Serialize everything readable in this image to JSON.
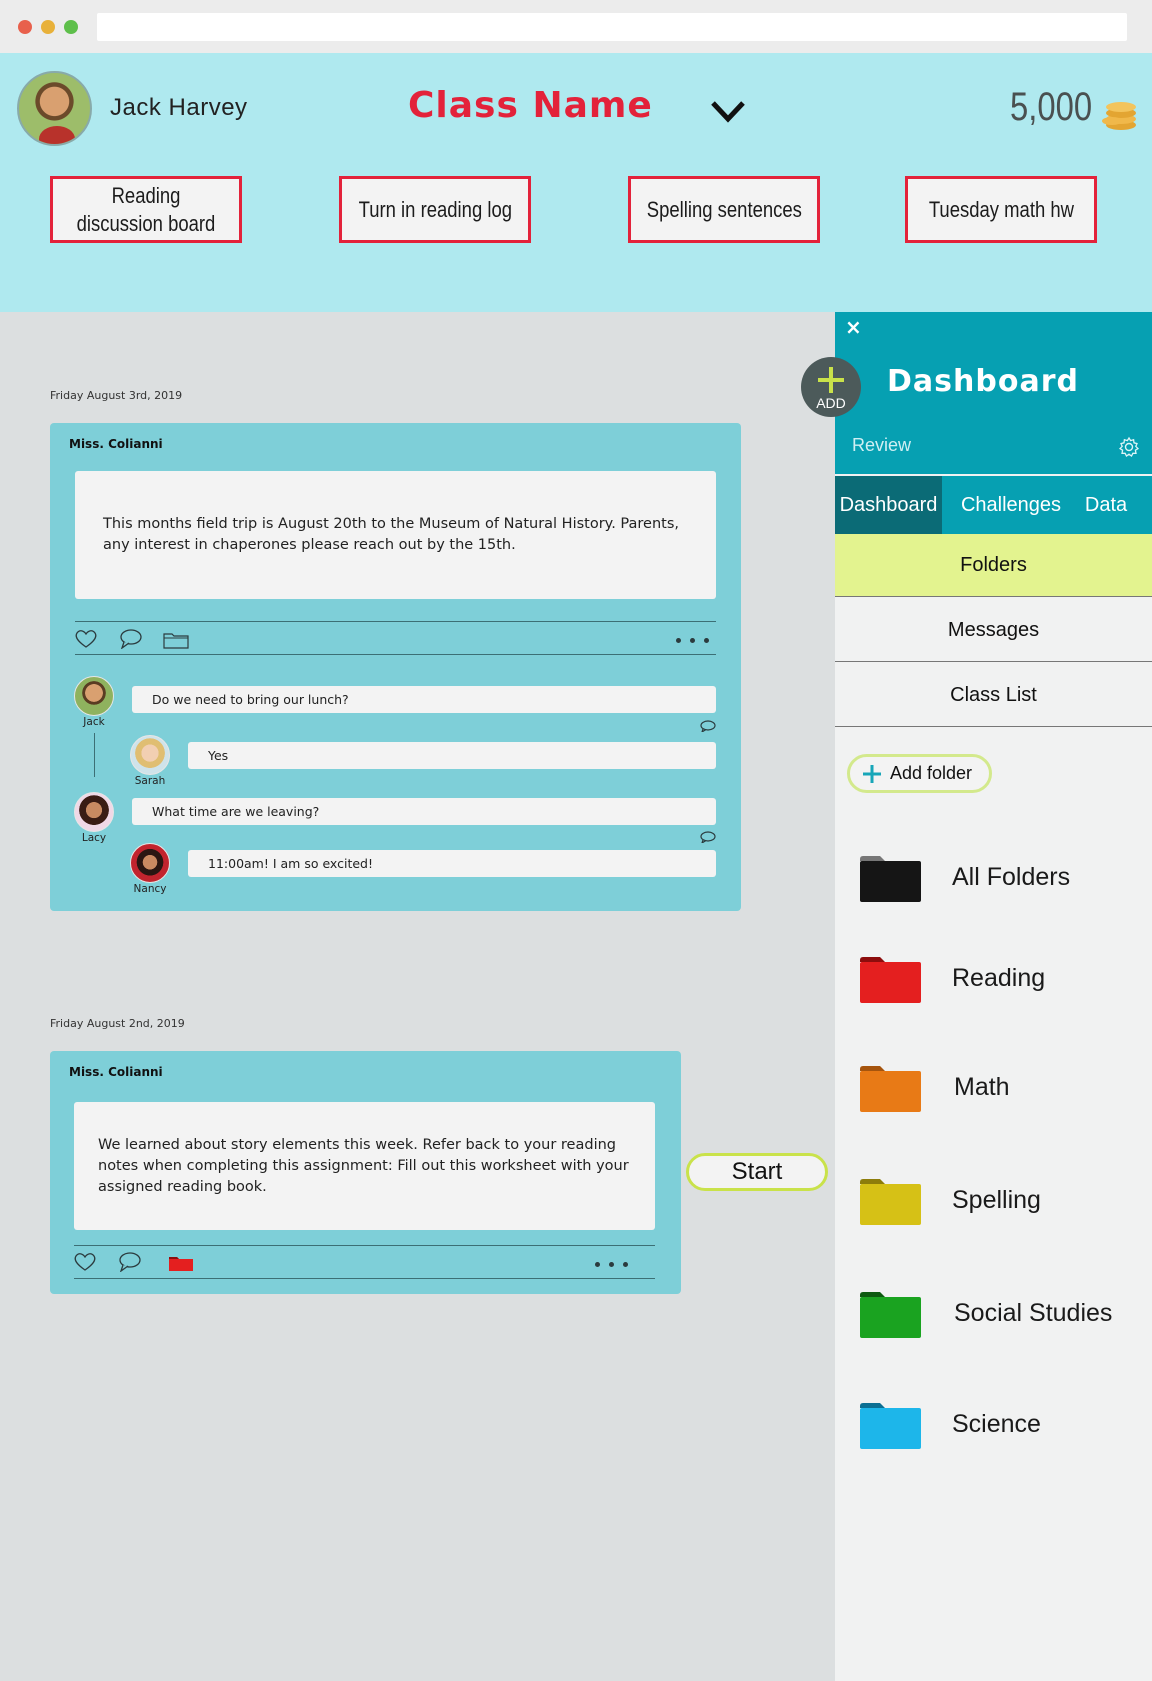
{
  "user": {
    "name": "Jack Harvey"
  },
  "header": {
    "class_name": "Class Name",
    "coins": "5,000"
  },
  "assignments": [
    "Reading discussion board",
    "Turn in reading log",
    "Spelling sentences",
    "Tuesday math hw"
  ],
  "posts": [
    {
      "date": "Friday August 3rd, 2019",
      "author": "Miss. Colianni",
      "body": "This months field trip is August 20th to the  Museum of  Natural  History.  Parents, any interest in chaperones please reach out by the 15th.",
      "comments": [
        {
          "name": "Jack",
          "text": "Do we need to bring our lunch?"
        },
        {
          "name": "Sarah",
          "text": "Yes"
        },
        {
          "name": "Lacy",
          "text": "What time are we leaving?"
        },
        {
          "name": "Nancy",
          "text": "11:00am!  I am so excited!"
        }
      ]
    },
    {
      "date": "Friday August 2nd, 2019",
      "author": "Miss. Colianni",
      "body": "We learned about story elements this week.  Refer back to your reading notes when completing this assignment:  Fill out this worksheet with your assigned reading book.",
      "action": "Start"
    }
  ],
  "fab": {
    "label": "ADD"
  },
  "sidebar": {
    "close": "×",
    "title": "Dashboard",
    "subtitle": "Review",
    "tabs": [
      "Dashboard",
      "Challenges",
      "Data"
    ],
    "menu": [
      "Folders",
      "Messages",
      "Class List"
    ],
    "add_folder": "Add folder",
    "folders": [
      {
        "name": "All  Folders",
        "color": "#151515",
        "tab": "#777777"
      },
      {
        "name": "Reading",
        "color": "#e41f1f",
        "tab": "#8c0d0d"
      },
      {
        "name": "Math",
        "color": "#e87a16",
        "tab": "#a5540d"
      },
      {
        "name": "Spelling",
        "color": "#d6c116",
        "tab": "#8d7d0b"
      },
      {
        "name": "Social Studies",
        "color": "#1aa320",
        "tab": "#0d5a10"
      },
      {
        "name": "Science",
        "color": "#1db6ea",
        "tab": "#0b6f93"
      }
    ]
  }
}
